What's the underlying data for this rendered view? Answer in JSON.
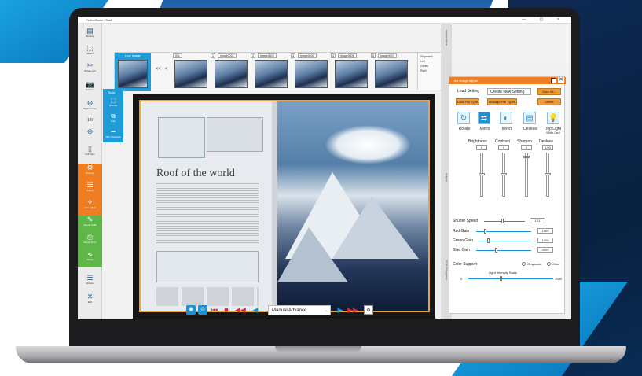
{
  "app": {
    "title": "PerfectScan - Staff",
    "window_controls": "— ▢ ✕"
  },
  "leftnav": {
    "items": [
      {
        "label": "Browse",
        "icon": "browse-icon",
        "glyph": "▤"
      },
      {
        "label": "Select",
        "icon": "select-icon",
        "glyph": "⬚"
      },
      {
        "label": "Rotate Cut",
        "icon": "scissors-icon",
        "glyph": "✂"
      },
      {
        "label": "Capture",
        "icon": "camera-icon",
        "glyph": "📷"
      },
      {
        "label": "Digital Zoom",
        "icon": "zoom-in-icon",
        "glyph": "⊕"
      },
      {
        "label": "1.0",
        "icon": "",
        "glyph": ""
      },
      {
        "label": "",
        "icon": "zoom-out-icon",
        "glyph": "⊖"
      },
      {
        "label": "Full View",
        "icon": "full-view-icon",
        "glyph": "▯"
      },
      {
        "label": "Settings",
        "icon": "settings-icon",
        "glyph": "⚙"
      },
      {
        "label": "Adjust",
        "icon": "adjust-icon",
        "glyph": "☷"
      },
      {
        "label": "Auto Adjust",
        "icon": "auto-adjust-icon",
        "glyph": "✧"
      },
      {
        "label": "Export USB",
        "icon": "export-usb-icon",
        "glyph": "✎"
      },
      {
        "label": "Export Print",
        "icon": "print-icon",
        "glyph": "⎙"
      },
      {
        "label": "Share",
        "icon": "share-icon",
        "glyph": "⋖"
      },
      {
        "label": "Options",
        "icon": "options-icon",
        "glyph": "☰"
      },
      {
        "label": "Exit",
        "icon": "exit-icon",
        "glyph": "✕"
      }
    ]
  },
  "thumbstrip": {
    "live_label": "Live Image",
    "prev_all": "<<",
    "prev": "<",
    "next": ">",
    "next_all": ">>",
    "thumbs": [
      {
        "name": "001",
        "num": "1"
      },
      {
        "name": "Image0002",
        "num": "2"
      },
      {
        "name": "Image0003",
        "num": "3"
      },
      {
        "name": "Image0004",
        "num": "4"
      },
      {
        "name": "Image0005",
        "num": "5"
      },
      {
        "name": "Image0007",
        "num": "6"
      }
    ],
    "alignment": {
      "title": "Alignment",
      "left": "Left",
      "center": "Center",
      "right": "Right"
    }
  },
  "tools": {
    "title": "Tools",
    "items": [
      {
        "label": "Manual"
      },
      {
        "label": "Auto"
      },
      {
        "label": "WB Threshold"
      }
    ]
  },
  "book": {
    "title": "Roof of the world"
  },
  "controls": {
    "advance_mode": "Manual Advance"
  },
  "side_tabs": [
    "Information",
    "Adjust",
    "OCR Progress"
  ],
  "adjust": {
    "header": "Live Image Adjust",
    "load_setting_label": "Load Setting",
    "setting_select": "Create New Setting",
    "save_as": "Save As...",
    "load_file_type": "Load File Type",
    "manage_file_types": "Manage File Types",
    "delete": "Delete",
    "tools": [
      {
        "label": "Rotate",
        "icon": "rotate-icon",
        "glyph": "↻"
      },
      {
        "label": "Mirror",
        "icon": "mirror-icon",
        "glyph": "⇆"
      },
      {
        "label": "Invert",
        "icon": "invert-icon",
        "glyph": "◐"
      },
      {
        "label": "Deskew",
        "icon": "deskew-icon",
        "glyph": "▤"
      },
      {
        "label": "Top Light",
        "icon": "top-light-icon",
        "glyph": "💡"
      }
    ],
    "top_light_sub": "White Card",
    "sliders": [
      {
        "label": "Brightness",
        "value": "0",
        "level": 0.5
      },
      {
        "label": "Contrast",
        "value": "0",
        "level": 0.5
      },
      {
        "label": "Sharpen",
        "value": "0",
        "level": 0.95
      },
      {
        "label": "Deskew",
        "value": "1.00",
        "level": 0.5
      }
    ],
    "shutter": {
      "label": "Shutter Speed",
      "value": "131"
    },
    "red": {
      "label": "Red Gain",
      "value": "1000"
    },
    "green": {
      "label": "Green Gain",
      "value": "1000"
    },
    "blue": {
      "label": "Blue Gain",
      "value": "4000"
    },
    "color_support": {
      "label": "Color Support",
      "grayscale": "Grayscale",
      "color": "Color"
    },
    "light_intensity": {
      "label": "Light Intensity Scale",
      "min": "0",
      "max": "1000"
    }
  },
  "colors": {
    "accent": "#1f9bd7",
    "orange": "#ef7d22",
    "green": "#5eb746"
  }
}
